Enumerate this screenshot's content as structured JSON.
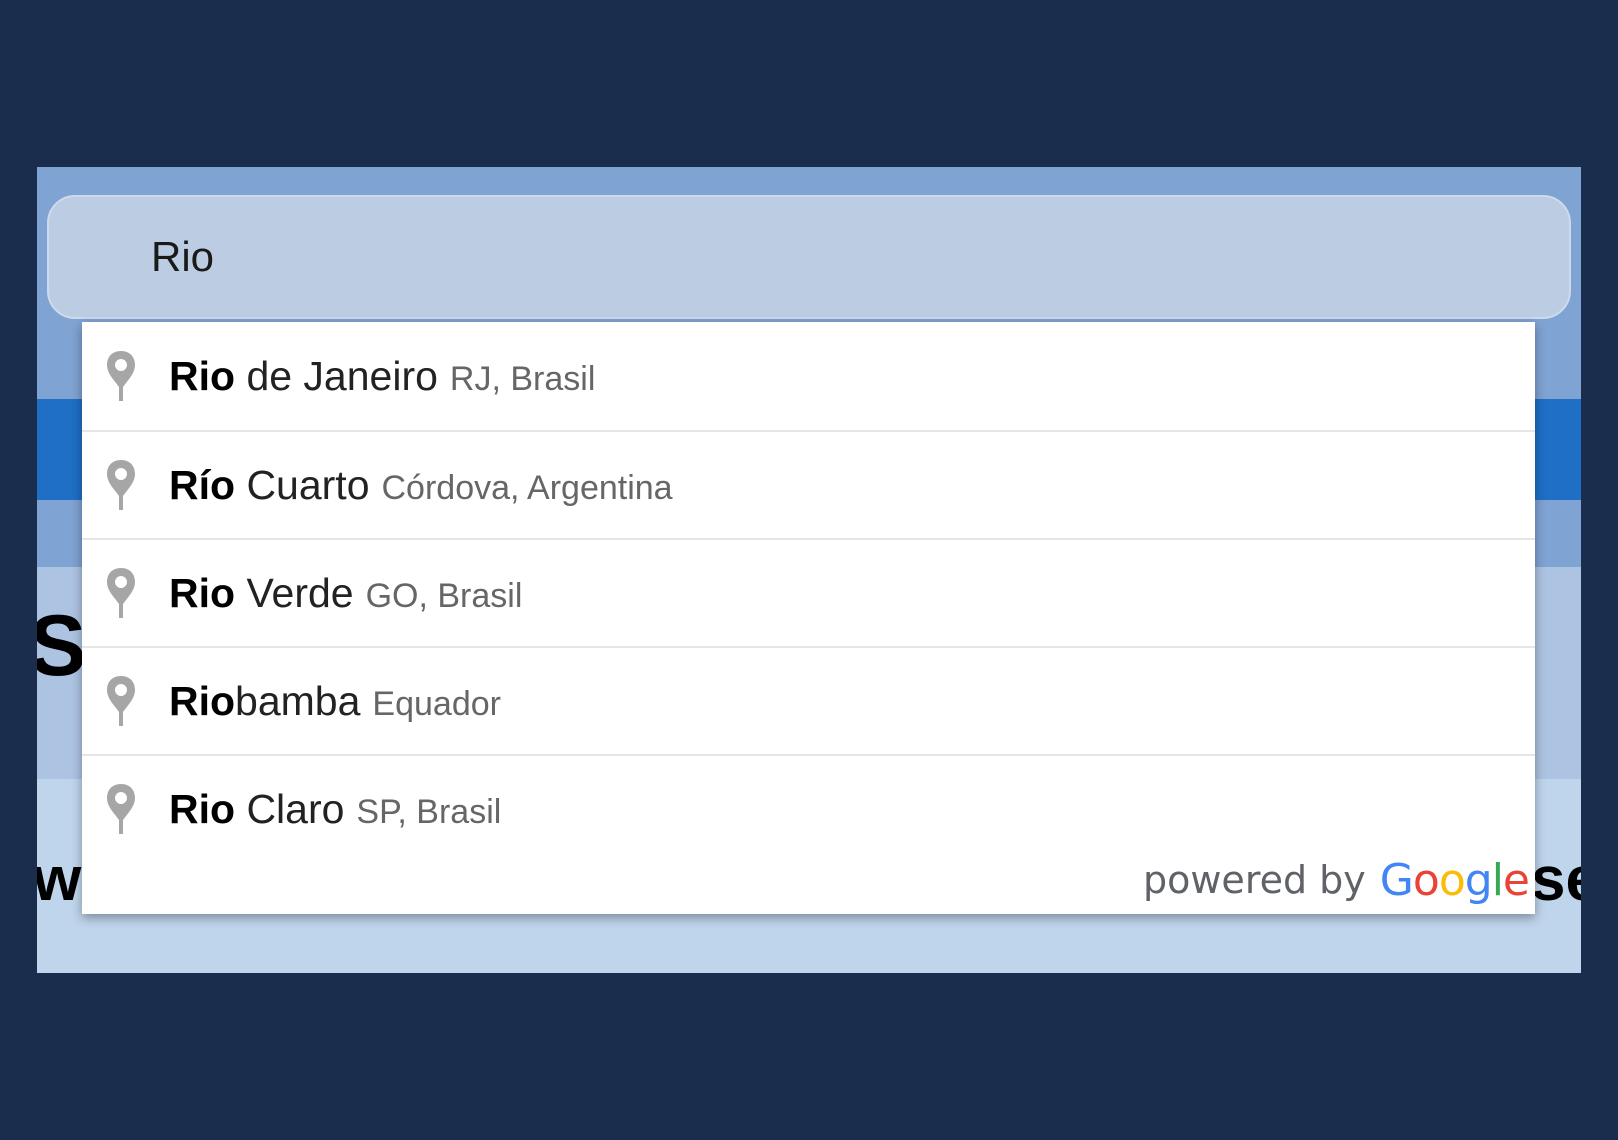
{
  "search": {
    "value": "Rio"
  },
  "suggestions": [
    {
      "match": "Rio",
      "rest": " de Janeiro",
      "secondary": "RJ, Brasil"
    },
    {
      "match": "Río",
      "rest": " Cuarto",
      "secondary": "Córdova, Argentina"
    },
    {
      "match": "Rio",
      "rest": " Verde",
      "secondary": "GO, Brasil"
    },
    {
      "match": "Rio",
      "rest": "bamba",
      "secondary": "Equador"
    },
    {
      "match": "Rio",
      "rest": " Claro",
      "secondary": "SP, Brasil"
    }
  ],
  "attribution": {
    "powered_by": "powered by",
    "brand": "Google",
    "brand_letters": [
      {
        "char": "G",
        "color": "#4285F4"
      },
      {
        "char": "o",
        "color": "#EA4335"
      },
      {
        "char": "o",
        "color": "#FBBC05"
      },
      {
        "char": "g",
        "color": "#4285F4"
      },
      {
        "char": "l",
        "color": "#34A853"
      },
      {
        "char": "e",
        "color": "#EA4335"
      }
    ]
  },
  "background": {
    "text_left_top": "St",
    "text_left_bottom": "w",
    "text_right_bottom": "se"
  },
  "icons": {
    "suggestion_icon": "map-pin-icon"
  },
  "colors": {
    "page_bg": "#1b2d4d",
    "header_band": "#1f6fc6",
    "input_bg": "#bccde3",
    "pin": "#a6a6a6"
  }
}
